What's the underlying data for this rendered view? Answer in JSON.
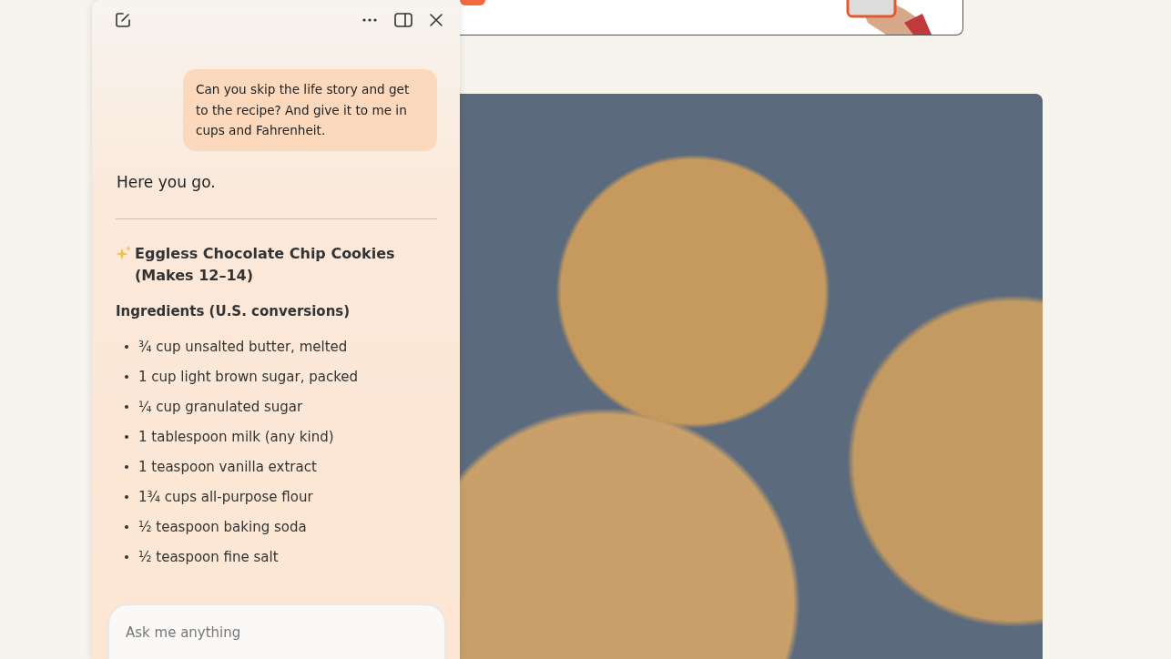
{
  "chat": {
    "user_message": "Can you skip the life story and get to the recipe? And give it to me in cups and Fahrenheit.",
    "reply": "Here you go.",
    "recipe_title": "Eggless Chocolate Chip Cookies (Makes 12–14)",
    "section_heading": "Ingredients (U.S. conversions)",
    "ingredients": [
      "¾ cup unsalted butter, melted",
      "1 cup light brown sugar, packed",
      "¼ cup granulated sugar",
      "1 tablespoon milk (any kind)",
      "1 teaspoon vanilla extract",
      "1¾ cups all-purpose flour",
      "½ teaspoon baking soda",
      "½ teaspoon fine salt"
    ]
  },
  "composer": {
    "placeholder": "Ask me anything"
  }
}
